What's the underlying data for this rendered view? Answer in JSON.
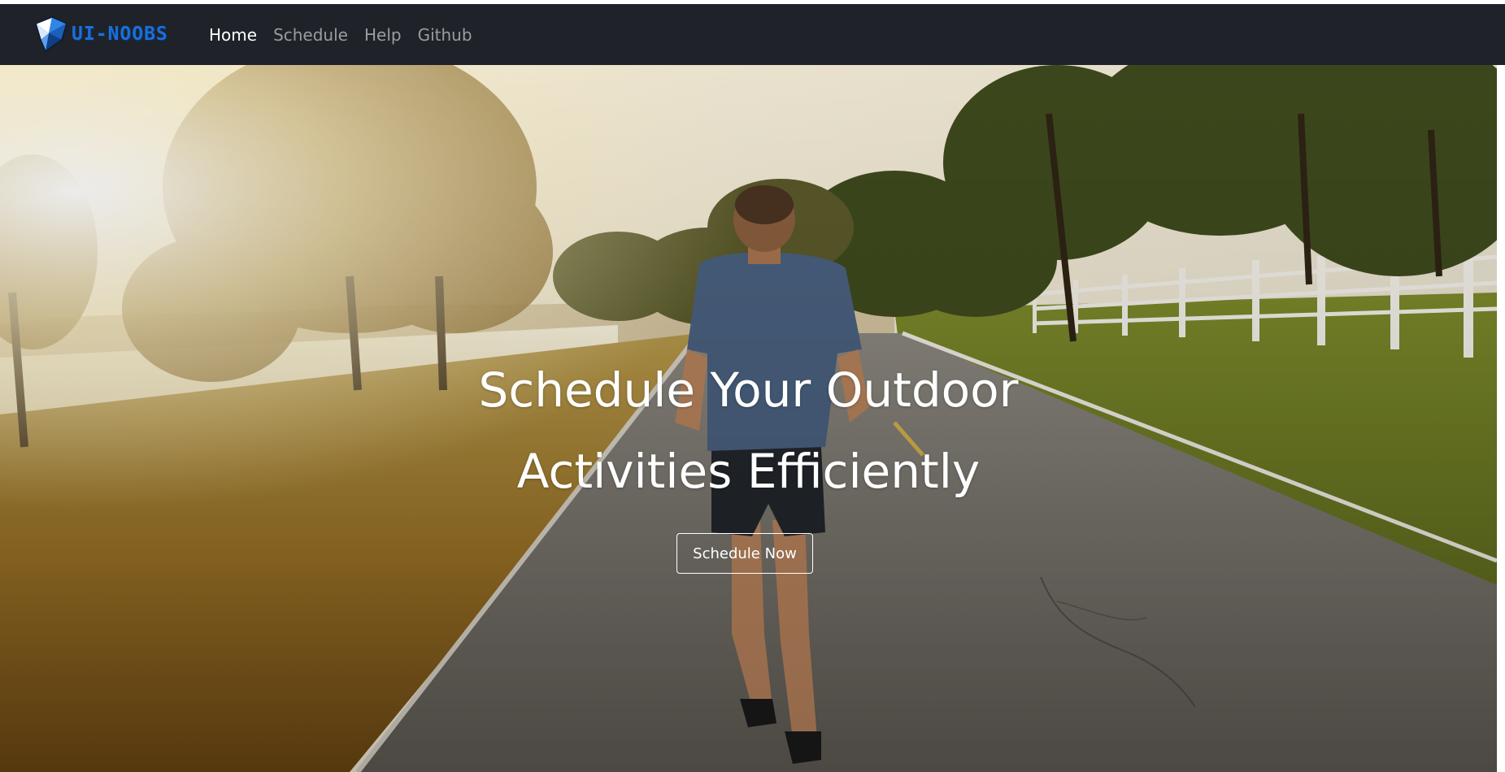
{
  "navbar": {
    "brand_text": "UI-NOOBS",
    "brand_icon": "origami-bird-logo",
    "links": [
      {
        "label": "Home",
        "active": true
      },
      {
        "label": "Schedule",
        "active": false
      },
      {
        "label": "Help",
        "active": false
      },
      {
        "label": "Github",
        "active": false
      }
    ],
    "background": "#1f2329",
    "brand_color": "#1b6fd9"
  },
  "hero": {
    "title_line1": "Schedule Your Outdoor",
    "title_line2": "Activities Efficiently",
    "cta_label": "Schedule Now",
    "background_image": "runner-on-road-at-sunrise"
  }
}
